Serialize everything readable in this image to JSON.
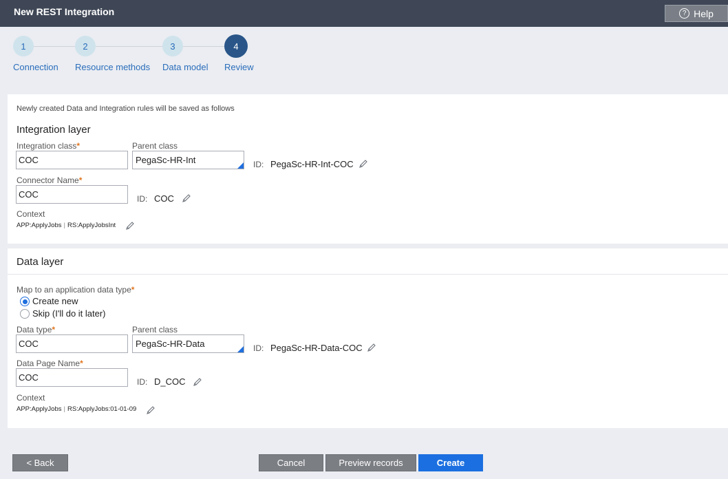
{
  "header": {
    "title": "New REST Integration",
    "help_label": "Help",
    "help_icon": "question-circle-icon"
  },
  "steps": [
    {
      "number": "1",
      "label": "Connection"
    },
    {
      "number": "2",
      "label": "Resource methods"
    },
    {
      "number": "3",
      "label": "Data model"
    },
    {
      "number": "4",
      "label": "Review"
    }
  ],
  "active_step": 4,
  "integration": {
    "note": "Newly created Data and Integration rules will be saved as follows",
    "title": "Integration layer",
    "class_label": "Integration class",
    "class_value": "COC",
    "parent_label": "Parent class",
    "parent_value": "PegaSc-HR-Int",
    "id_label": "ID:",
    "id_value": "PegaSc-HR-Int-COC",
    "connector_label": "Connector Name",
    "connector_value": "COC",
    "connector_id_label": "ID:",
    "connector_id_value": "COC",
    "context_label": "Context",
    "context_app": "APP:ApplyJobs",
    "context_sep": "|",
    "context_rs": "RS:ApplyJobsInt"
  },
  "data_layer": {
    "title": "Data layer",
    "map_label": "Map to an application data type",
    "option_create": "Create new",
    "option_skip": "Skip (I'll do it later)",
    "selected_option": "Create new",
    "type_label": "Data type",
    "type_value": "COC",
    "parent_label": "Parent class",
    "parent_value": "PegaSc-HR-Data",
    "id_label": "ID:",
    "id_value": "PegaSc-HR-Data-COC",
    "page_label": "Data Page Name",
    "page_value": "COC",
    "page_id_label": "ID:",
    "page_id_value": "D_COC",
    "context_label": "Context",
    "context_app": "APP:ApplyJobs",
    "context_sep": "|",
    "context_rs": "RS:ApplyJobs:01-01-09"
  },
  "required_marker": "*",
  "footer": {
    "back": "< Back",
    "cancel": "Cancel",
    "preview": "Preview records",
    "create": "Create"
  },
  "colors": {
    "header_bg": "#3f4756",
    "accent": "#1b6fe0",
    "required": "#e0761f",
    "active_step": "#295589"
  }
}
